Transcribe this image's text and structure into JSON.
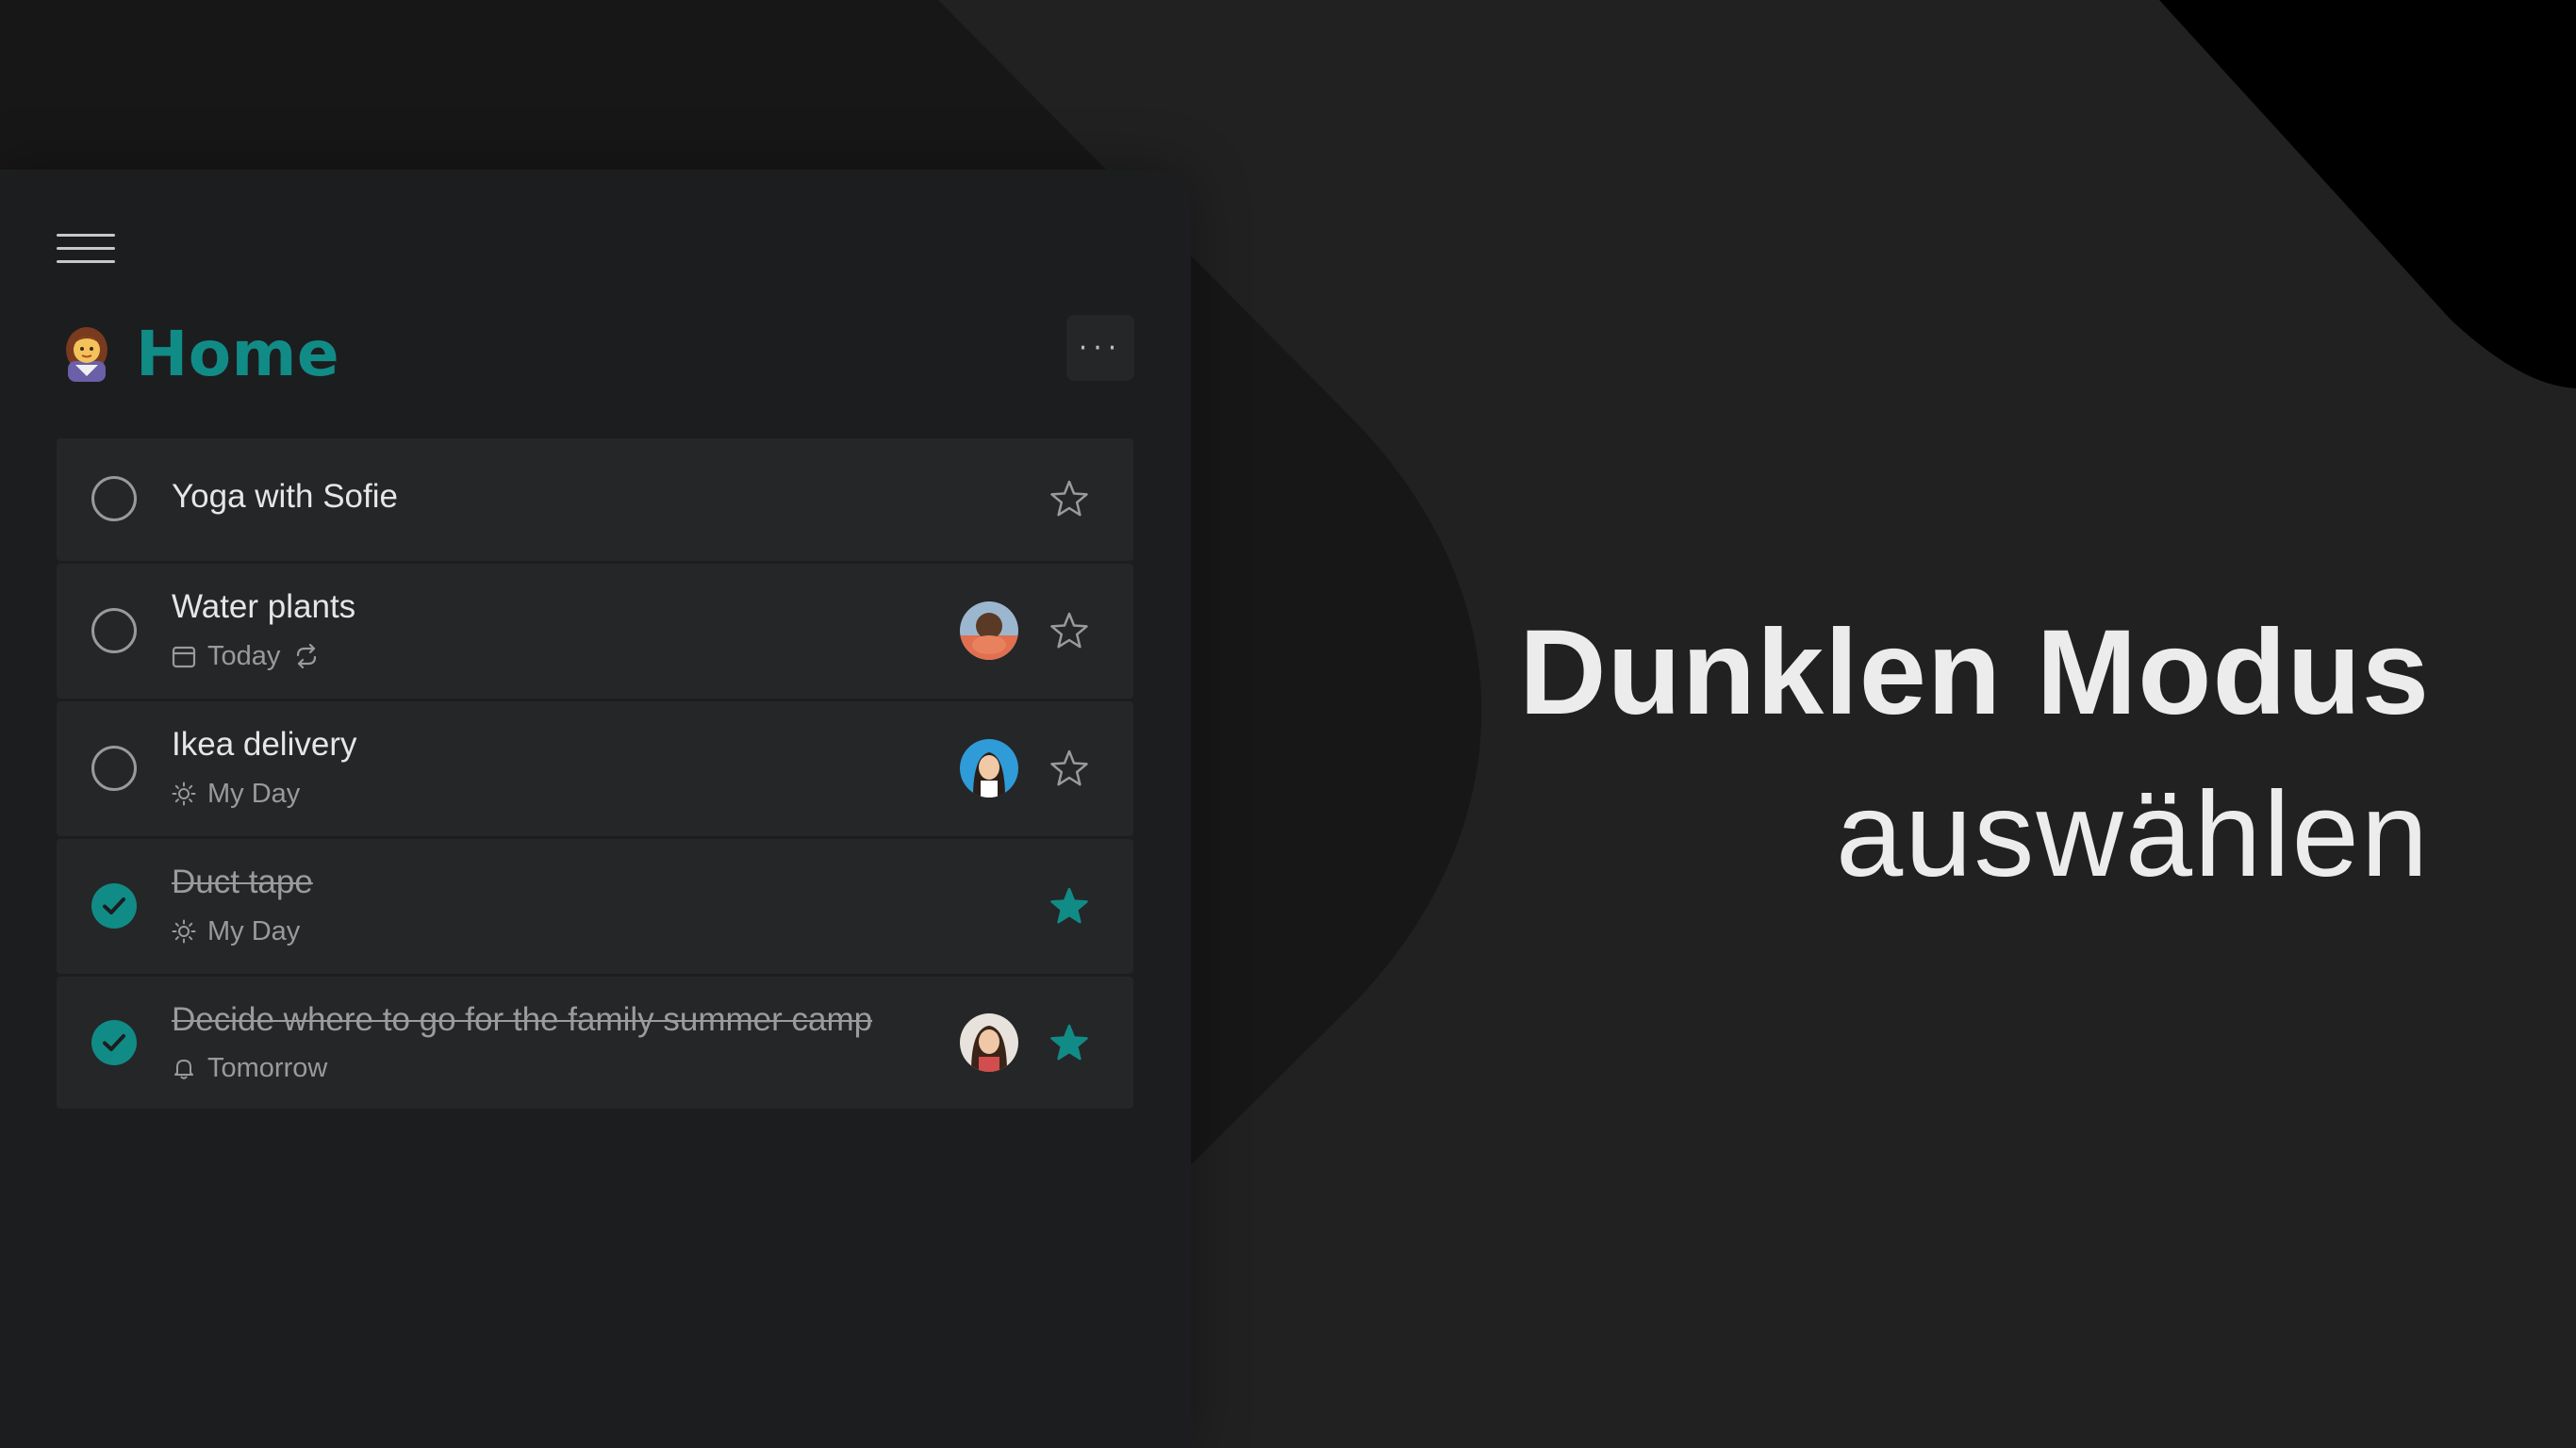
{
  "headline": {
    "line1": "Dunklen Modus",
    "line2": "auswählen"
  },
  "app": {
    "menu_icon": "hamburger-menu-icon",
    "list": {
      "emoji_icon": "woman-emoji-icon",
      "title": "Home",
      "title_color": "#118b86",
      "more_label": "···"
    },
    "tasks": [
      {
        "title": "Yoga with Sofie",
        "completed": false,
        "important": false,
        "meta": null,
        "assignee": false
      },
      {
        "title": "Water plants",
        "completed": false,
        "important": false,
        "meta": {
          "icon": "calendar-icon",
          "text": "Today",
          "repeat_icon": "repeat-icon"
        },
        "assignee": true
      },
      {
        "title": "Ikea delivery",
        "completed": false,
        "important": false,
        "meta": {
          "icon": "sun-icon",
          "text": "My Day"
        },
        "assignee": true
      },
      {
        "title": "Duct tape",
        "completed": true,
        "important": true,
        "meta": {
          "icon": "sun-icon",
          "text": "My Day"
        },
        "assignee": false
      },
      {
        "title": "Decide where to go for the family summer camp",
        "completed": true,
        "important": true,
        "meta": {
          "icon": "bell-icon",
          "text": "Tomorrow"
        },
        "assignee": true
      }
    ]
  },
  "colors": {
    "accent": "#118b86",
    "panel": "#1c1d1f",
    "task_bg": "#252628",
    "background": "#212121"
  }
}
